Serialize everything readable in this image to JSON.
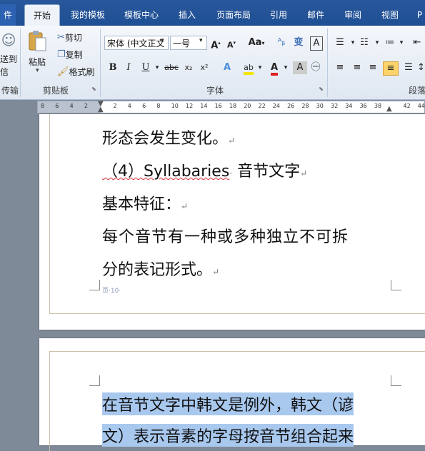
{
  "tabs": [
    {
      "label": "件"
    },
    {
      "label": "开始"
    },
    {
      "label": "我的模板"
    },
    {
      "label": "模板中心"
    },
    {
      "label": "插入"
    },
    {
      "label": "页面布局"
    },
    {
      "label": "引用"
    },
    {
      "label": "邮件"
    },
    {
      "label": "审阅"
    },
    {
      "label": "视图"
    },
    {
      "label": "P"
    }
  ],
  "ribbon": {
    "send_label_1": "送到",
    "send_label_2": "信",
    "send_group": "传输",
    "paste": "粘贴",
    "cut": "剪切",
    "copy": "复制",
    "format_painter": "格式刷",
    "clipboard_group": "剪贴板",
    "font_name": "宋体 (中文正文",
    "font_size": "一号",
    "font_group": "字体",
    "para_group": "段落"
  },
  "ruler": [
    "8",
    "6",
    "4",
    "2",
    "",
    "2",
    "4",
    "6",
    "8",
    "10",
    "12",
    "14",
    "16",
    "18",
    "20",
    "22",
    "24",
    "26",
    "28",
    "30",
    "32",
    "34",
    "36",
    "38",
    "",
    "42",
    "44"
  ],
  "page1": {
    "lines": [
      "形态会发生变化。",
      "（4）Syllabaries",
      "音节文字",
      "基本特征：",
      "每个音节有一种或多种独立不可拆",
      "分的表记形式。"
    ],
    "page_num": "页·10·"
  },
  "page2": {
    "lines": [
      "在音节文字中韩文是例外，韩文（谚",
      "文）表示音素的字母按音节组合起来"
    ]
  },
  "colors": {
    "accent": "#2b579a",
    "highlight": "#a8c8ee"
  }
}
